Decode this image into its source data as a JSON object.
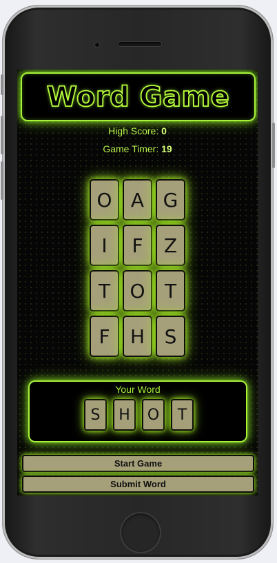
{
  "app": {
    "title": "Word Game"
  },
  "stats": {
    "high_score_label": "High Score:",
    "high_score_value": "0",
    "timer_label": "Game Timer:",
    "timer_value": "19"
  },
  "board": {
    "rows": [
      [
        "O",
        "A",
        "G"
      ],
      [
        "I",
        "F",
        "Z"
      ],
      [
        "T",
        "O",
        "T"
      ],
      [
        "F",
        "H",
        "S"
      ]
    ]
  },
  "word_panel": {
    "label": "Your Word",
    "letters": [
      "S",
      "H",
      "O",
      "T"
    ]
  },
  "buttons": {
    "start": "Start Game",
    "submit": "Submit Word"
  },
  "colors": {
    "neon_green": "#a8f23a",
    "tile": "#a6a07a",
    "background": "#060606"
  }
}
